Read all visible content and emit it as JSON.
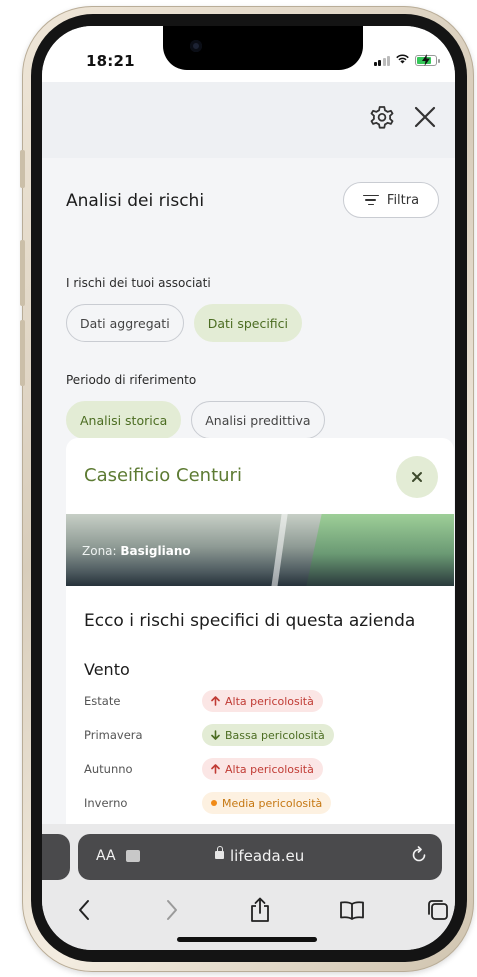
{
  "status_bar": {
    "time": "18:21",
    "battery_level": 0.7,
    "charging": true
  },
  "header": {
    "icons": [
      "gear-icon",
      "close-icon"
    ]
  },
  "page": {
    "title": "Analisi dei rischi",
    "filter_label": "Filtra"
  },
  "associates_section": {
    "label": "I rischi dei tuoi associati",
    "chips": [
      {
        "label": "Dati aggregati",
        "active": false
      },
      {
        "label": "Dati specifici",
        "active": true
      }
    ]
  },
  "period_section": {
    "label": "Periodo di riferimento",
    "chips": [
      {
        "label": "Analisi storica",
        "active": true
      },
      {
        "label": "Analisi predittiva",
        "active": false
      }
    ]
  },
  "card": {
    "company_name": "Caseificio Centuri",
    "zone_prefix": "Zona:",
    "zone_name": "Basigliano",
    "heading": "Ecco i rischi specifici di questa azienda",
    "category": "Vento",
    "risks": [
      {
        "season": "Estate",
        "level": "Alta pericolosità",
        "type": "alta",
        "icon": "arrow-up-icon"
      },
      {
        "season": "Primavera",
        "level": "Bassa pericolosità",
        "type": "bassa",
        "icon": "arrow-down-icon"
      },
      {
        "season": "Autunno",
        "level": "Alta pericolosità",
        "type": "alta",
        "icon": "arrow-up-icon"
      },
      {
        "season": "Inverno",
        "level": "Media pericolosità",
        "type": "media",
        "icon": "dot-icon"
      }
    ]
  },
  "browser": {
    "text_size_label": "AA",
    "url": "lifeada.eu"
  },
  "colors": {
    "accent_green": "#5d7b33",
    "chip_active_bg": "#e3ecd5",
    "danger_red": "#c03b34",
    "warning_orange": "#f08a16"
  }
}
